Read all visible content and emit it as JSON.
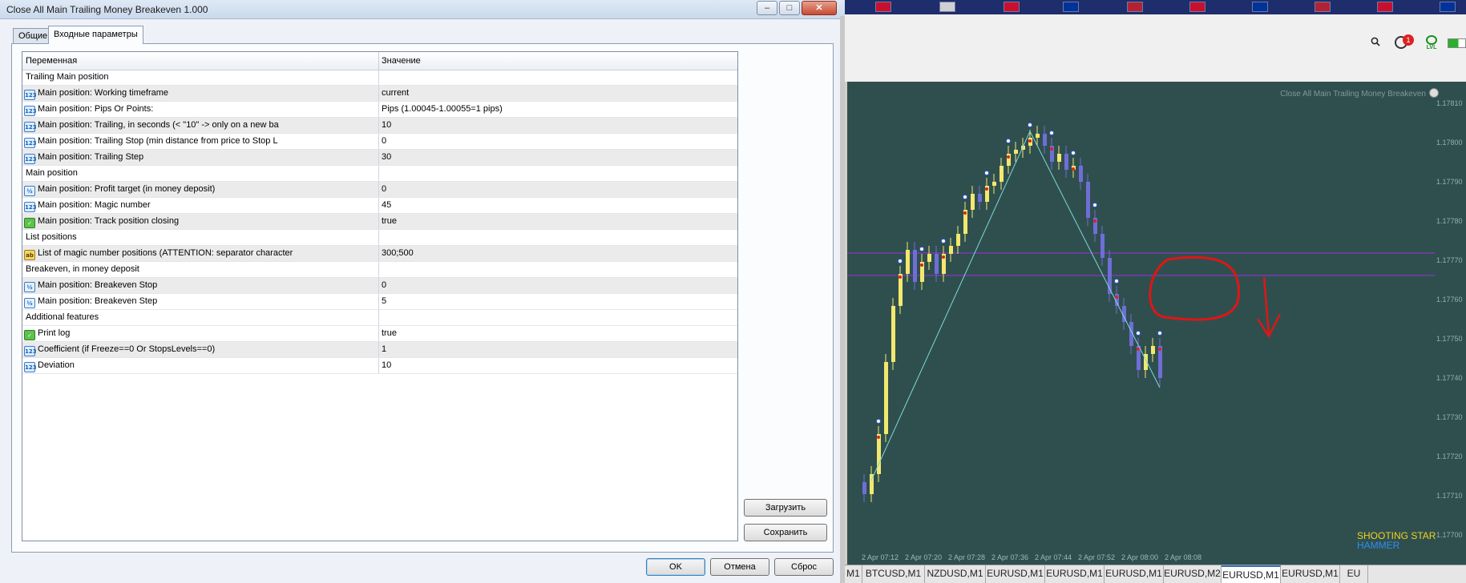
{
  "window": {
    "title": "Close All Main Trailing Money Breakeven 1.000",
    "minimize": "–",
    "maximize": "□",
    "close": "✕"
  },
  "tabs": [
    {
      "label": "Общие"
    },
    {
      "label": "Входные параметры"
    }
  ],
  "grid": {
    "col_variable": "Переменная",
    "col_value": "Значение",
    "rows": [
      {
        "type": "group",
        "name": "Trailing Main position",
        "value": ""
      },
      {
        "type": "int",
        "name": "Main position: Working timeframe",
        "value": "current"
      },
      {
        "type": "int",
        "name": "Main position: Pips Or Points:",
        "value": "Pips (1.00045-1.00055=1 pips)"
      },
      {
        "type": "int",
        "name": "Main position: Trailing, in seconds (< \"10\" -> only on a new ba",
        "value": "10"
      },
      {
        "type": "int",
        "name": "Main position: Trailing Stop (min distance from price to Stop L",
        "value": "0"
      },
      {
        "type": "int",
        "name": "Main position: Trailing Step",
        "value": "30"
      },
      {
        "type": "group",
        "name": "Main position",
        "value": ""
      },
      {
        "type": "dbl",
        "name": "Main position: Profit target (in money deposit)",
        "value": "0"
      },
      {
        "type": "int",
        "name": "Main position: Magic number",
        "value": "45"
      },
      {
        "type": "bool",
        "name": "Main position: Track position closing",
        "value": "true"
      },
      {
        "type": "group",
        "name": "List positions",
        "value": ""
      },
      {
        "type": "str",
        "name": "List of magic number positions (ATTENTION: separator character",
        "value": "300;500"
      },
      {
        "type": "group",
        "name": "Breakeven, in money deposit",
        "value": ""
      },
      {
        "type": "dbl",
        "name": "Main position: Breakeven Stop",
        "value": "0"
      },
      {
        "type": "dbl",
        "name": "Main position: Breakeven Step",
        "value": "5"
      },
      {
        "type": "group",
        "name": "Additional features",
        "value": ""
      },
      {
        "type": "bool",
        "name": "Print log",
        "value": "true"
      },
      {
        "type": "int",
        "name": "Coefficient (if Freeze==0 Or StopsLevels==0)",
        "value": "1"
      },
      {
        "type": "int",
        "name": "Deviation",
        "value": "10"
      }
    ]
  },
  "buttons": {
    "load": "Загрузить",
    "save": "Сохранить",
    "ok": "OK",
    "cancel": "Отмена",
    "reset": "Сброс"
  },
  "toolbar": {
    "notification_count": "1",
    "lvl_label": "LVL"
  },
  "chart": {
    "title": "Close All Main Trailing Money Breakeven",
    "legend": [
      "SHOOTING STAR",
      "HAMMER"
    ],
    "y_ticks": [
      "1.17810",
      "1.17800",
      "1.17790",
      "1.17780",
      "1.17770",
      "1.17760",
      "1.17750",
      "1.17740",
      "1.17730",
      "1.17720",
      "1.17710",
      "1.17700"
    ],
    "x_ticks": [
      "2 Apr 07:12",
      "2 Apr 07:20",
      "2 Apr 07:28",
      "2 Apr 07:36",
      "2 Apr 07:44",
      "2 Apr 07:52",
      "2 Apr 08:00",
      "2 Apr 08:08"
    ],
    "colors": {
      "background": "#2f4f4f",
      "bull": "#f2e86d",
      "bear": "#6f6ed6",
      "level_line": "#9b30d9",
      "zigzag": "#7fd8d8",
      "annotation": "#e01515"
    }
  },
  "symbol_tabs": [
    "M1",
    "BTCUSD,M1",
    "NZDUSD,M1",
    "EURUSD,M1",
    "EURUSD,M1",
    "EURUSD,M1",
    "EURUSD,M2",
    "EURUSD,M1",
    "EURUSD,M1",
    "EU"
  ]
}
